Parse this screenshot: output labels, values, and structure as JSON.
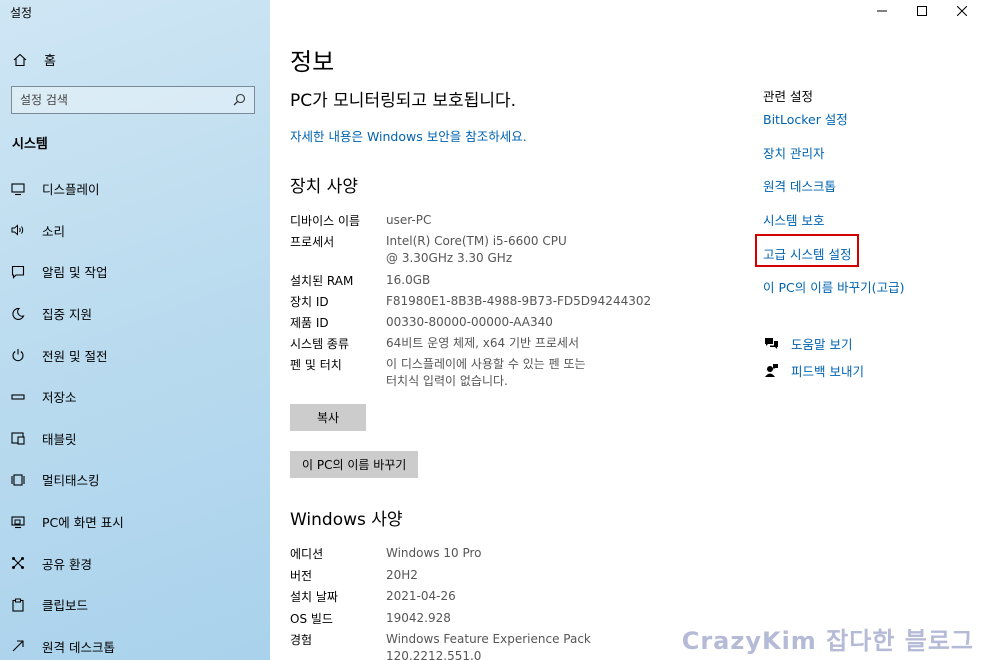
{
  "window": {
    "title": "설정"
  },
  "sidebar": {
    "home_label": "홈",
    "search_placeholder": "설정 검색",
    "section": "시스템",
    "items": [
      {
        "label": "디스플레이",
        "icon": "monitor-icon"
      },
      {
        "label": "소리",
        "icon": "speaker-icon"
      },
      {
        "label": "알림 및 작업",
        "icon": "notification-icon"
      },
      {
        "label": "집중 지원",
        "icon": "moon-icon"
      },
      {
        "label": "전원 및 절전",
        "icon": "power-icon"
      },
      {
        "label": "저장소",
        "icon": "storage-icon"
      },
      {
        "label": "태블릿",
        "icon": "tablet-icon"
      },
      {
        "label": "멀티태스킹",
        "icon": "multitask-icon"
      },
      {
        "label": "PC에 화면 표시",
        "icon": "project-icon"
      },
      {
        "label": "공유 환경",
        "icon": "share-icon"
      },
      {
        "label": "클립보드",
        "icon": "clipboard-icon"
      },
      {
        "label": "원격 데스크톱",
        "icon": "remote-icon"
      }
    ]
  },
  "main": {
    "title": "정보",
    "protect_text": "PC가 모니터링되고 보호됩니다.",
    "security_link": "자세한 내용은 Windows 보안을 참조하세요.",
    "device_spec": {
      "heading": "장치 사양",
      "rows": [
        {
          "key": "디바이스 이름",
          "value": "user-PC"
        },
        {
          "key": "프로세서",
          "value": "Intel(R) Core(TM) i5-6600 CPU @ 3.30GHz   3.30 GHz"
        },
        {
          "key": "설치된 RAM",
          "value": "16.0GB"
        },
        {
          "key": "장치 ID",
          "value": "F81980E1-8B3B-4988-9B73-FD5D94244302"
        },
        {
          "key": "제품 ID",
          "value": "00330-80000-00000-AA340"
        },
        {
          "key": "시스템 종류",
          "value": "64비트 운영 체제, x64 기반 프로세서"
        },
        {
          "key": "펜 및 터치",
          "value": "이 디스플레이에 사용할 수 있는 펜 또는 터치식 입력이 없습니다."
        }
      ],
      "copy_button": "복사",
      "rename_button": "이 PC의 이름 바꾸기"
    },
    "windows_spec": {
      "heading": "Windows 사양",
      "rows": [
        {
          "key": "에디션",
          "value": "Windows 10 Pro"
        },
        {
          "key": "버전",
          "value": "20H2"
        },
        {
          "key": "설치 날짜",
          "value": "2021-04-26"
        },
        {
          "key": "OS 빌드",
          "value": "19042.928"
        },
        {
          "key": "경험",
          "value": "Windows Feature Experience Pack 120.2212.551.0"
        }
      ]
    }
  },
  "related": {
    "title": "관련 설정",
    "links": [
      "BitLocker 설정",
      "장치 관리자",
      "원격 데스크톱",
      "시스템 보호",
      "고급 시스템 설정",
      "이 PC의 이름 바꾸기(고급)"
    ],
    "help": [
      {
        "label": "도움말 보기",
        "icon": "help-icon"
      },
      {
        "label": "피드백 보내기",
        "icon": "feedback-icon"
      }
    ]
  },
  "watermark": "CrazyKim 잡다한 블로그",
  "colors": {
    "link": "#0063b1",
    "highlight": "#d40000",
    "sidebar": "#bcdcef"
  }
}
